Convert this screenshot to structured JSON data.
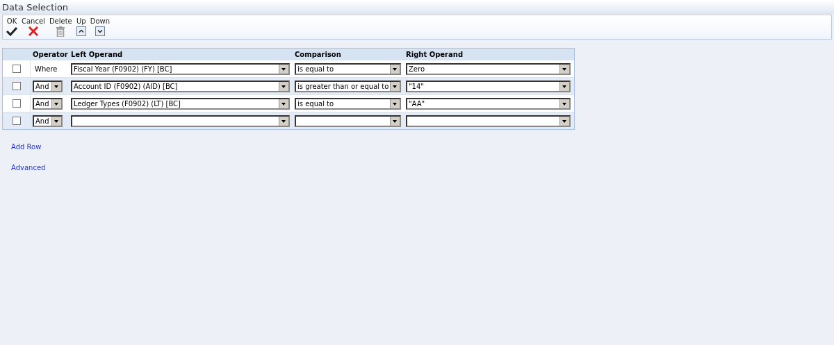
{
  "title": "Data Selection",
  "toolbar": [
    {
      "label": "OK",
      "kind": "check"
    },
    {
      "label": "Cancel",
      "kind": "cross"
    },
    {
      "label": "Delete",
      "kind": "trash"
    },
    {
      "label": "Up",
      "kind": "up"
    },
    {
      "label": "Down",
      "kind": "down"
    }
  ],
  "table": {
    "columns": [
      "Operator",
      "Left Operand",
      "Comparison",
      "Right Operand"
    ],
    "rows": [
      {
        "checked": false,
        "operator": {
          "kind": "text",
          "value": "Where"
        },
        "left": "Fiscal Year (F0902) (FY) [BC]",
        "comparison": "is equal to",
        "right": "Zero"
      },
      {
        "checked": false,
        "operator": {
          "kind": "dropdown",
          "value": "And"
        },
        "left": "Account ID (F0902) (AID) [BC]",
        "comparison": "is greater than or equal to",
        "right": "\"14\""
      },
      {
        "checked": false,
        "operator": {
          "kind": "dropdown",
          "value": "And"
        },
        "left": "Ledger Types (F0902) (LT) [BC]",
        "comparison": "is equal to",
        "right": "\"AA\""
      },
      {
        "checked": false,
        "operator": {
          "kind": "dropdown",
          "value": "And"
        }
      }
    ]
  },
  "links": [
    "Add Row",
    "Advanced"
  ]
}
